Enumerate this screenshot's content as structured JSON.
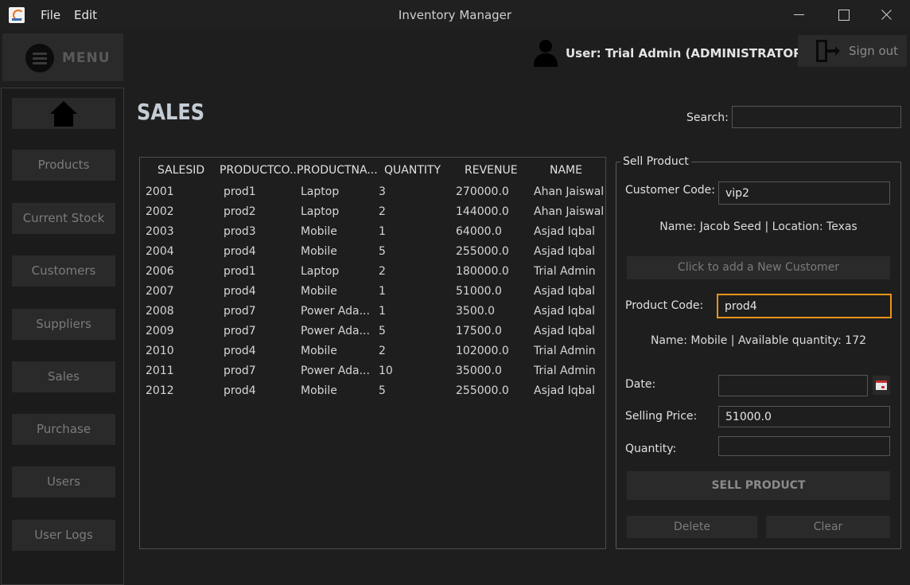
{
  "window": {
    "title": "Inventory Manager",
    "menus": [
      "File",
      "Edit"
    ]
  },
  "header": {
    "menu_label": "MENU",
    "user_label": "User: Trial Admin (ADMINISTRATOR)",
    "signout_label": "Sign out"
  },
  "sidebar": {
    "items": [
      {
        "label": "Products"
      },
      {
        "label": "Current Stock"
      },
      {
        "label": "Customers"
      },
      {
        "label": "Suppliers"
      },
      {
        "label": "Sales"
      },
      {
        "label": "Purchase"
      },
      {
        "label": "Users"
      },
      {
        "label": "User Logs"
      }
    ]
  },
  "page": {
    "title": "SALES",
    "search_label": "Search:",
    "search_value": ""
  },
  "table": {
    "columns": [
      "SALESID",
      "PRODUCTCO...",
      "PRODUCTNA...",
      "QUANTITY",
      "REVENUE",
      "NAME"
    ],
    "rows": [
      [
        "2001",
        "prod1",
        "Laptop",
        "3",
        "270000.0",
        "Ahan Jaiswal"
      ],
      [
        "2002",
        "prod2",
        "Laptop",
        "2",
        "144000.0",
        "Ahan Jaiswal"
      ],
      [
        "2003",
        "prod3",
        "Mobile",
        "1",
        "64000.0",
        "Asjad Iqbal"
      ],
      [
        "2004",
        "prod4",
        "Mobile",
        "5",
        "255000.0",
        "Asjad Iqbal"
      ],
      [
        "2006",
        "prod1",
        "Laptop",
        "2",
        "180000.0",
        "Trial Admin"
      ],
      [
        "2007",
        "prod4",
        "Mobile",
        "1",
        "51000.0",
        "Asjad Iqbal"
      ],
      [
        "2008",
        "prod7",
        "Power Ada...",
        "1",
        "3500.0",
        "Asjad Iqbal"
      ],
      [
        "2009",
        "prod7",
        "Power Ada...",
        "5",
        "17500.0",
        "Asjad Iqbal"
      ],
      [
        "2010",
        "prod4",
        "Mobile",
        "2",
        "102000.0",
        "Trial Admin"
      ],
      [
        "2011",
        "prod7",
        "Power Ada...",
        "10",
        "35000.0",
        "Trial Admin"
      ],
      [
        "2012",
        "prod4",
        "Mobile",
        "5",
        "255000.0",
        "Asjad Iqbal"
      ]
    ]
  },
  "sell_panel": {
    "legend": "Sell Product",
    "customer_code_label": "Customer Code:",
    "customer_code_value": "vip2",
    "customer_info": "Name: Jacob Seed | Location: Texas",
    "add_customer_label": "Click to add a New Customer",
    "product_code_label": "Product Code:",
    "product_code_value": "prod4",
    "product_info": "Name: Mobile | Available quantity: 172",
    "date_label": "Date:",
    "date_value": "",
    "selling_price_label": "Selling Price:",
    "selling_price_value": "51000.0",
    "quantity_label": "Quantity:",
    "quantity_value": "",
    "sell_button_label": "SELL PRODUCT",
    "delete_label": "Delete",
    "clear_label": "Clear"
  },
  "colors": {
    "focus_border": "#e8941c",
    "background": "#1e1e1e",
    "button_bg": "#2a2a2a"
  }
}
